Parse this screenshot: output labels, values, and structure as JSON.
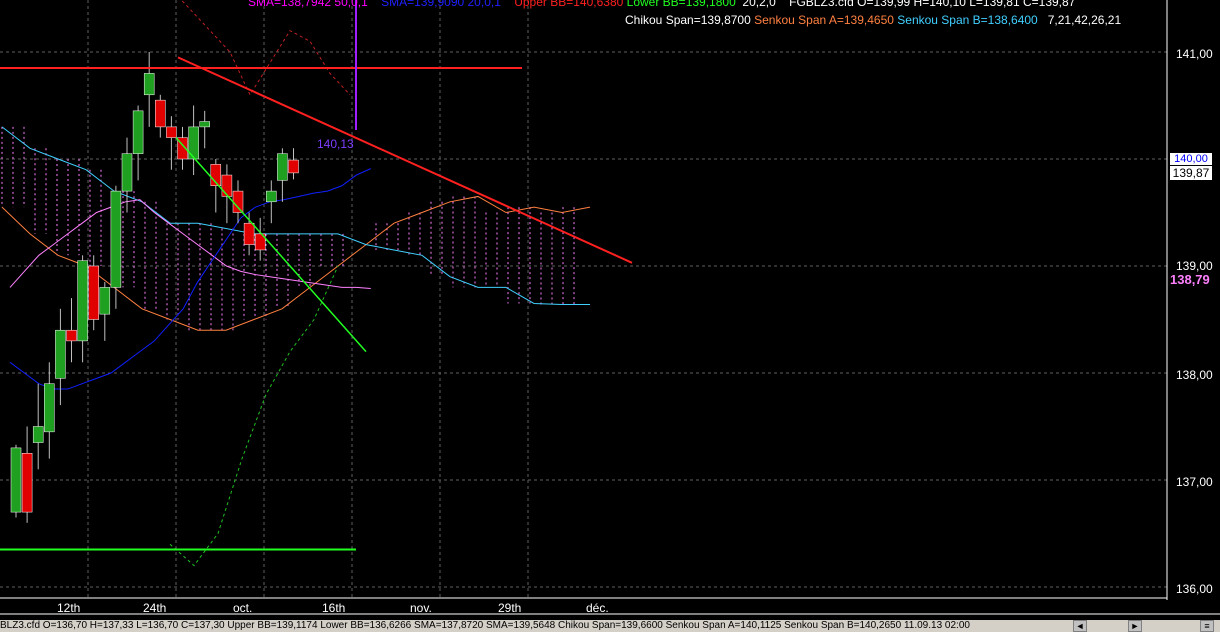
{
  "legend": {
    "row1": [
      {
        "text": "SMA=138,7942  50,0,1",
        "color": "#ff00ff"
      },
      {
        "text": "SMA=139,9090  20,0,1",
        "color": "#2020ff"
      },
      {
        "text": "Upper BB=140,6380",
        "color": "#ff2020"
      },
      {
        "text": "Lower BB=139,1800",
        "color": "#20ff20"
      },
      {
        "text": "20,2,0",
        "color": "#ffffff"
      },
      {
        "text": "FGBLZ3.cfd O=139,99 H=140,10 L=139,81 C=139,87",
        "color": "#ffffff"
      }
    ],
    "row2": [
      {
        "text": "Chikou Span=139,8700",
        "color": "#ffffff"
      },
      {
        "text": "Senkou Span A=139,4650",
        "color": "#ff8040"
      },
      {
        "text": "Senkou Span B=138,6400",
        "color": "#40d0ff"
      },
      {
        "text": "7,21,42,26,21",
        "color": "#ffffff"
      }
    ]
  },
  "price_axis": [
    "141,00",
    "140,00",
    "139,00",
    "138,00",
    "137,00",
    "136,00"
  ],
  "current_price": "139,87",
  "ohlc_tag": "140,00",
  "sma_axis_value": "138,79",
  "chart_annotation": "140,13",
  "date_axis": [
    "12th",
    "24th",
    "oct.",
    "16th",
    "nov.",
    "29th",
    "déc."
  ],
  "status_bar": "BLZ3.cfd O=136,70 H=137,33 L=136,70 C=137,30  Upper BB=139,1174 Lower BB=136,6266 SMA=137,8720 SMA=139,5648 Chikou Span=139,6600 Senkou Span A=140,1125 Senkou Span B=140,2650  11.09.13 02:00",
  "colors": {
    "bull": "#20a020",
    "bear": "#e00000",
    "resistance": "#ff2020",
    "support": "#20ff20",
    "sma50": "#ff80ff",
    "sma20": "#1020ff",
    "chikou": "#ffffff",
    "senkouA": "#ff8040",
    "senkouB": "#40d0ff"
  },
  "chart_data": {
    "type": "candlestick",
    "ylim": [
      136.0,
      141.2
    ],
    "candles": [
      {
        "o": 136.7,
        "h": 137.33,
        "l": 136.65,
        "c": 137.3
      },
      {
        "o": 137.25,
        "h": 137.5,
        "l": 136.6,
        "c": 136.7
      },
      {
        "o": 137.35,
        "h": 137.9,
        "l": 137.1,
        "c": 137.5
      },
      {
        "o": 137.45,
        "h": 138.1,
        "l": 137.2,
        "c": 137.9
      },
      {
        "o": 137.95,
        "h": 138.6,
        "l": 137.7,
        "c": 138.4
      },
      {
        "o": 138.4,
        "h": 138.7,
        "l": 138.1,
        "c": 138.3
      },
      {
        "o": 138.3,
        "h": 139.1,
        "l": 138.1,
        "c": 139.05
      },
      {
        "o": 139.0,
        "h": 139.1,
        "l": 138.4,
        "c": 138.5
      },
      {
        "o": 138.55,
        "h": 138.85,
        "l": 138.3,
        "c": 138.8
      },
      {
        "o": 138.8,
        "h": 139.75,
        "l": 138.6,
        "c": 139.7
      },
      {
        "o": 139.7,
        "h": 140.2,
        "l": 139.5,
        "c": 140.05
      },
      {
        "o": 140.05,
        "h": 140.5,
        "l": 139.8,
        "c": 140.45
      },
      {
        "o": 140.6,
        "h": 141.0,
        "l": 140.3,
        "c": 140.8
      },
      {
        "o": 140.55,
        "h": 140.6,
        "l": 140.2,
        "c": 140.3
      },
      {
        "o": 140.3,
        "h": 140.4,
        "l": 139.9,
        "c": 140.2
      },
      {
        "o": 140.2,
        "h": 140.3,
        "l": 139.9,
        "c": 140.0
      },
      {
        "o": 140.0,
        "h": 140.5,
        "l": 139.85,
        "c": 140.3
      },
      {
        "o": 140.3,
        "h": 140.45,
        "l": 140.1,
        "c": 140.35
      },
      {
        "o": 139.95,
        "h": 140.0,
        "l": 139.5,
        "c": 139.75
      },
      {
        "o": 139.85,
        "h": 139.95,
        "l": 139.4,
        "c": 139.65
      },
      {
        "o": 139.7,
        "h": 139.8,
        "l": 139.4,
        "c": 139.5
      },
      {
        "o": 139.4,
        "h": 139.5,
        "l": 139.1,
        "c": 139.2
      },
      {
        "o": 139.3,
        "h": 139.45,
        "l": 139.05,
        "c": 139.15
      },
      {
        "o": 139.6,
        "h": 139.8,
        "l": 139.4,
        "c": 139.7
      },
      {
        "o": 139.8,
        "h": 140.1,
        "l": 139.6,
        "c": 140.05
      },
      {
        "o": 139.99,
        "h": 140.1,
        "l": 139.81,
        "c": 139.87
      }
    ],
    "sma50": [
      138.8,
      138.95,
      139.1,
      139.2,
      139.3,
      139.4,
      139.5,
      139.55,
      139.6,
      139.62,
      139.5,
      139.4,
      139.3,
      139.2,
      139.1,
      139.0,
      138.95,
      138.92,
      138.9,
      138.88,
      138.86,
      138.84,
      138.82,
      138.8,
      138.8,
      138.79
    ],
    "sma20": [
      138.1,
      138.0,
      137.9,
      137.85,
      137.85,
      137.9,
      137.95,
      138.0,
      138.1,
      138.2,
      138.3,
      138.45,
      138.6,
      138.85,
      139.05,
      139.25,
      139.45,
      139.55,
      139.6,
      139.62,
      139.65,
      139.68,
      139.7,
      139.75,
      139.85,
      139.91
    ],
    "resistance_lines": [
      {
        "from": [
          0,
          140.85
        ],
        "to": [
          22,
          140.85
        ]
      },
      {
        "from": [
          11,
          140.95
        ],
        "to": [
          37,
          139.05
        ]
      }
    ],
    "support_line": {
      "from": [
        0,
        136.35
      ],
      "to": [
        22,
        136.35
      ]
    },
    "green_trend": {
      "from": [
        11,
        140.2
      ],
      "to": [
        22,
        138.2
      ]
    }
  }
}
